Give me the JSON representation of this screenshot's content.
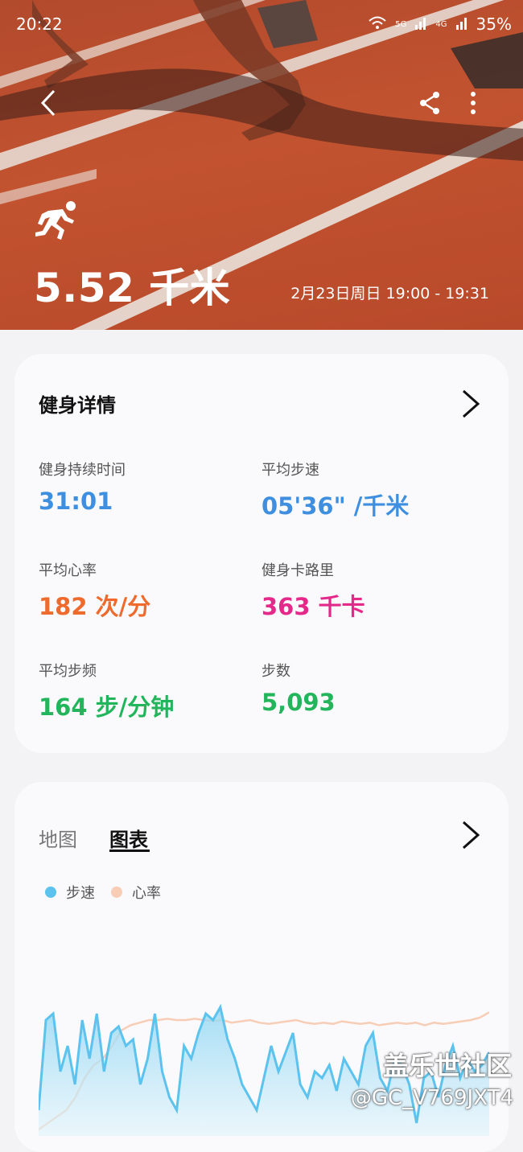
{
  "status_bar": {
    "time": "20:22",
    "battery": "35%",
    "net1": "5G",
    "net2": "4G"
  },
  "header": {
    "distance": "5.52 千米",
    "datetime": "2月23日周日 19:00 - 19:31",
    "icons": [
      "back-icon",
      "share-icon",
      "more-icon",
      "running-icon"
    ]
  },
  "details": {
    "title": "健身详情",
    "metrics": [
      {
        "label": "健身持续时间",
        "value": "31:01",
        "color": "#3f8fe0"
      },
      {
        "label": "平均步速",
        "value": "05'36\" /千米",
        "color": "#3f8fe0"
      },
      {
        "label": "平均心率",
        "value": "182 次/分",
        "color": "#ee6a2d"
      },
      {
        "label": "健身卡路里",
        "value": "363 千卡",
        "color": "#e5298a"
      },
      {
        "label": "平均步频",
        "value": "164 步/分钟",
        "color": "#23b55c"
      },
      {
        "label": "步数",
        "value": "5,093",
        "color": "#23b55c"
      }
    ]
  },
  "chart_card": {
    "tabs": [
      "地图",
      "图表"
    ],
    "active_tab": "图表",
    "legend": [
      {
        "name": "步速",
        "color": "#5bc3ee"
      },
      {
        "name": "心率",
        "color": "#f7cdb6"
      }
    ]
  },
  "chart_data": {
    "type": "area",
    "series": [
      {
        "name": "步速",
        "values": [
          0.2,
          0.9,
          0.95,
          0.5,
          0.7,
          0.4,
          0.9,
          0.6,
          0.95,
          0.5,
          0.8,
          0.85,
          0.7,
          0.75,
          0.4,
          0.6,
          0.95,
          0.5,
          0.3,
          0.2,
          0.7,
          0.6,
          0.8,
          0.95,
          0.9,
          1.0,
          0.75,
          0.6,
          0.4,
          0.3,
          0.2,
          0.45,
          0.7,
          0.5,
          0.65,
          0.8,
          0.4,
          0.3,
          0.5,
          0.45,
          0.55,
          0.35,
          0.6,
          0.5,
          0.4,
          0.7,
          0.8,
          0.45,
          0.35,
          0.6,
          0.55,
          0.4,
          0.1,
          0.45,
          0.5,
          0.3,
          0.55,
          0.7,
          0.45,
          0.6,
          0.5,
          0.55,
          0.65
        ]
      },
      {
        "name": "心率",
        "values": [
          0.05,
          0.1,
          0.15,
          0.2,
          0.3,
          0.45,
          0.55,
          0.6,
          0.7,
          0.82,
          0.86,
          0.88,
          0.9,
          0.9,
          0.91,
          0.9,
          0.9,
          0.91,
          0.9,
          0.89,
          0.9,
          0.88,
          0.89,
          0.9,
          0.88,
          0.87,
          0.88,
          0.89,
          0.9,
          0.88,
          0.87,
          0.88,
          0.87,
          0.89,
          0.88,
          0.87,
          0.88,
          0.86,
          0.87,
          0.88,
          0.87,
          0.88,
          0.86,
          0.88,
          0.87,
          0.88,
          0.89,
          0.9,
          0.92,
          0.96
        ]
      }
    ]
  },
  "watermark": {
    "line1": "盖乐世社区",
    "line2": "@GC_V769JXT4"
  }
}
